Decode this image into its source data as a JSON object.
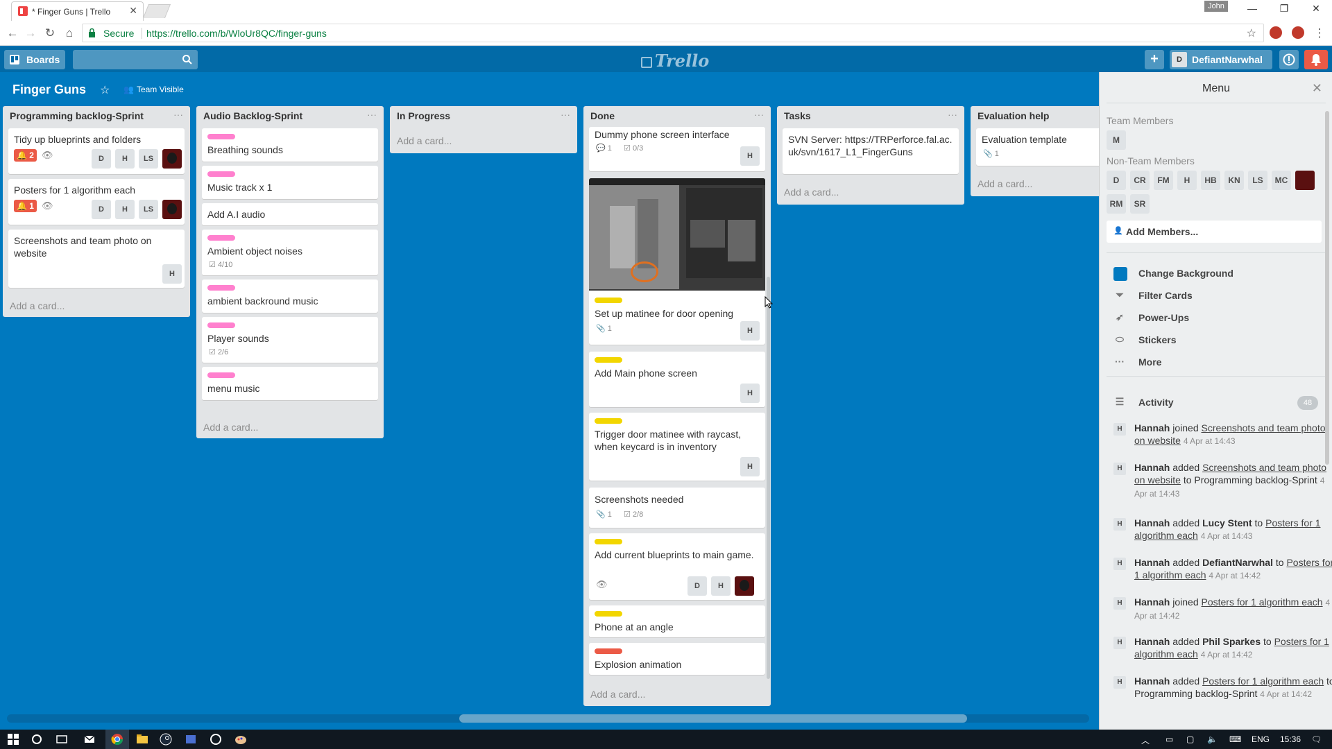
{
  "browser": {
    "tab_title": "* Finger Guns | Trello",
    "user_badge": "John",
    "secure_label": "Secure",
    "url": "https://trello.com/b/WloUr8QC/finger-guns"
  },
  "header": {
    "boards_label": "Boards",
    "logo": "Trello",
    "user_initial": "D",
    "user_name": "DefiantNarwhal"
  },
  "board": {
    "title": "Finger Guns",
    "visibility": "Team Visible"
  },
  "lists": [
    {
      "title": "Programming backlog-Sprint",
      "add_card": "Add a card...",
      "cards": [
        {
          "title": "Tidy up blueprints and folders",
          "alarm": "2",
          "members": [
            "D",
            "H",
            "LS"
          ]
        },
        {
          "title": "Posters for 1 algorithm each",
          "alarm": "1",
          "members": [
            "D",
            "H",
            "LS"
          ]
        },
        {
          "title": "Screenshots and team photo on website",
          "members": [
            "H"
          ]
        }
      ]
    },
    {
      "title": "Audio Backlog-Sprint",
      "add_card": "Add a card...",
      "cards": [
        {
          "title": "Breathing sounds"
        },
        {
          "title": "Music track x 1"
        },
        {
          "title": "Add A.I audio"
        },
        {
          "title": "Ambient object noises",
          "checklist": "4/10"
        },
        {
          "title": "ambient backround music"
        },
        {
          "title": "Player sounds",
          "checklist": "2/6"
        },
        {
          "title": "menu music"
        }
      ]
    },
    {
      "title": "In Progress",
      "add_card": "Add a card..."
    },
    {
      "title": "Done",
      "add_card": "Add a card...",
      "cards": [
        {
          "title": "Dummy phone screen interface",
          "comments": "1",
          "checklist": "0/3",
          "members": [
            "H"
          ]
        },
        {
          "title": "Set up matinee for door opening",
          "attachments": "1",
          "members": [
            "H"
          ]
        },
        {
          "title": "Add Main phone screen",
          "members": [
            "H"
          ]
        },
        {
          "title": "Trigger door matinee with raycast, when keycard is in inventory",
          "members": [
            "H"
          ]
        },
        {
          "title": "Screenshots needed",
          "attachments": "1",
          "checklist": "2/8"
        },
        {
          "title": "Add current blueprints to main game.",
          "members": [
            "D",
            "H"
          ]
        },
        {
          "title": "Phone at an angle"
        },
        {
          "title": "Explosion animation"
        }
      ]
    },
    {
      "title": "Tasks",
      "add_card": "Add a card...",
      "cards": [
        {
          "title": "SVN Server: https://TRPerforce.fal.ac.uk/svn/1617_L1_FingerGuns"
        }
      ]
    },
    {
      "title": "Evaluation help",
      "add_card": "Add a card...",
      "cards": [
        {
          "title": "Evaluation template",
          "attachments": "1"
        }
      ]
    }
  ],
  "menu": {
    "title": "Menu",
    "team_members_label": "Team Members",
    "team_members": [
      "M"
    ],
    "non_team_members_label": "Non-Team Members",
    "non_team_members": [
      "D",
      "CR",
      "FM",
      "H",
      "HB",
      "KN",
      "LS",
      "MC",
      "RM",
      "SR"
    ],
    "add_members": "Add Members...",
    "items": [
      "Change Background",
      "Filter Cards",
      "Power-Ups",
      "Stickers",
      "More"
    ],
    "activity_label": "Activity",
    "activity_count": "48",
    "activity": [
      {
        "who": "Hannah",
        "action": "joined",
        "target": "Screenshots and team photo on website",
        "rest": "",
        "time": "4 Apr at 14:43"
      },
      {
        "who": "Hannah",
        "action": "added",
        "target": "Screenshots and team photo on website",
        "rest": "to Programming backlog-Sprint",
        "time": "4 Apr at 14:43"
      },
      {
        "who": "Hannah",
        "action": "added",
        "person": "Lucy Stent",
        "target": "Posters for 1 algorithm each",
        "time": "4 Apr at 14:43"
      },
      {
        "who": "Hannah",
        "action": "added",
        "person": "DefiantNarwhal",
        "target": "Posters for 1 algorithm each",
        "time": "4 Apr at 14:42"
      },
      {
        "who": "Hannah",
        "action": "joined",
        "target": "Posters for 1 algorithm each",
        "rest": "",
        "time": "4 Apr at 14:42"
      },
      {
        "who": "Hannah",
        "action": "added",
        "person": "Phil Sparkes",
        "target": "Posters for 1 algorithm each",
        "time": "4 Apr at 14:42"
      },
      {
        "who": "Hannah",
        "action": "added",
        "target": "Posters for 1 algorithm each",
        "rest": "to Programming backlog-Sprint",
        "time": "4 Apr at 14:42"
      }
    ]
  },
  "taskbar": {
    "lang": "ENG",
    "time": "15:36"
  },
  "colors": {
    "board_bg": "#0079bf",
    "header_bg": "#026aa7",
    "label_pink": "#ff80ce",
    "label_yellow": "#f2d600",
    "label_red": "#eb5a46",
    "alarm_red": "#eb5a46"
  }
}
